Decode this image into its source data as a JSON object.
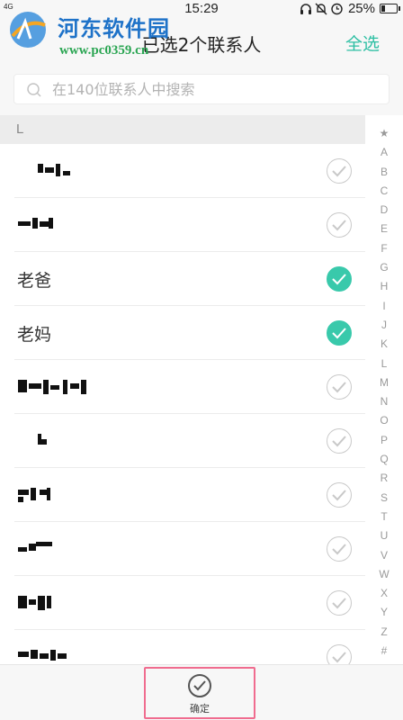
{
  "status_bar": {
    "signal": "4G",
    "time": "15:29",
    "battery_pct": "25%",
    "battery_level": 0.25,
    "icons": [
      "headset-icon",
      "mute-icon",
      "alarm-icon",
      "battery-icon"
    ]
  },
  "watermark": {
    "name": "河东软件园",
    "url": "www.pc0359.cn"
  },
  "header": {
    "title": "已选2个联系人",
    "select_all": "全选"
  },
  "search": {
    "placeholder": "在140位联系人中搜索",
    "value": ""
  },
  "section": {
    "letter": "L"
  },
  "contacts": [
    {
      "name": "",
      "blurred": true,
      "checked": false
    },
    {
      "name": "",
      "blurred": true,
      "checked": false
    },
    {
      "name": "老爸",
      "blurred": false,
      "checked": true
    },
    {
      "name": "老妈",
      "blurred": false,
      "checked": true
    },
    {
      "name": "",
      "blurred": true,
      "checked": false
    },
    {
      "name": "",
      "blurred": true,
      "checked": false
    },
    {
      "name": "",
      "blurred": true,
      "checked": false
    },
    {
      "name": "",
      "blurred": true,
      "checked": false
    },
    {
      "name": "",
      "blurred": true,
      "checked": false
    },
    {
      "name": "",
      "blurred": true,
      "checked": false
    }
  ],
  "alpha_index": [
    "★",
    "A",
    "B",
    "C",
    "D",
    "E",
    "F",
    "G",
    "H",
    "I",
    "J",
    "K",
    "L",
    "M",
    "N",
    "O",
    "P",
    "Q",
    "R",
    "S",
    "T",
    "U",
    "V",
    "W",
    "X",
    "Y",
    "Z",
    "#"
  ],
  "bottom_bar": {
    "confirm_label": "确定"
  },
  "colors": {
    "accent": "#39c9ab",
    "select_all": "#2dbfa3",
    "highlight_border": "#f06c8f"
  }
}
